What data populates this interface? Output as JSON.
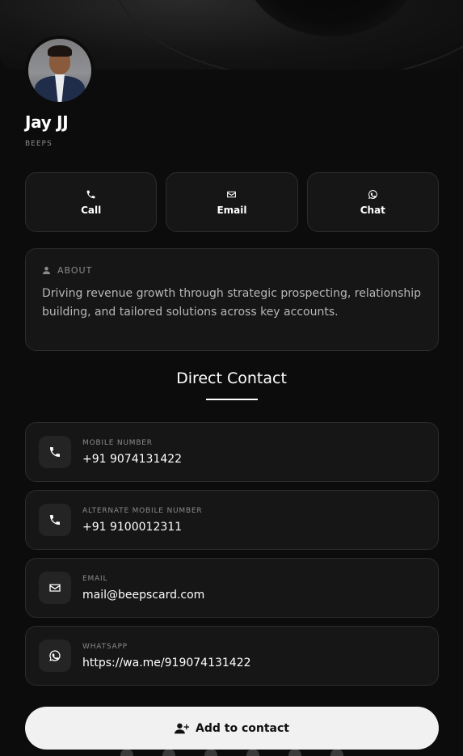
{
  "profile": {
    "name": "Jay JJ",
    "company": "BEEPS"
  },
  "actions": [
    {
      "label": "Call",
      "icon": "phone-icon"
    },
    {
      "label": "Email",
      "icon": "envelope-icon"
    },
    {
      "label": "Chat",
      "icon": "whatsapp-icon"
    }
  ],
  "about": {
    "title": "ABOUT",
    "icon": "user-icon",
    "text": "Driving revenue growth through strategic prospecting, relationship building, and tailored solutions across key accounts."
  },
  "section": {
    "title": "Direct Contact"
  },
  "contacts": [
    {
      "label": "MOBILE NUMBER",
      "value": "+91 9074131422",
      "icon": "phone-icon"
    },
    {
      "label": "ALTERNATE MOBILE NUMBER",
      "value": "+91 9100012311",
      "icon": "phone-icon"
    },
    {
      "label": "EMAIL",
      "value": "mail@beepscard.com",
      "icon": "envelope-icon"
    },
    {
      "label": "WHATSAPP",
      "value": "https://wa.me/919074131422",
      "icon": "whatsapp-icon"
    }
  ],
  "add_contact": {
    "label": "Add to contact",
    "icon": "user-plus-icon"
  },
  "social_icons": [
    "globe-icon",
    "x-icon",
    "facebook-icon",
    "instagram-icon",
    "linkedin-icon",
    "whatsapp-icon"
  ],
  "colors": {
    "background": "#0c0c0c",
    "card": "#161616",
    "button_light": "#f1f1f1"
  }
}
